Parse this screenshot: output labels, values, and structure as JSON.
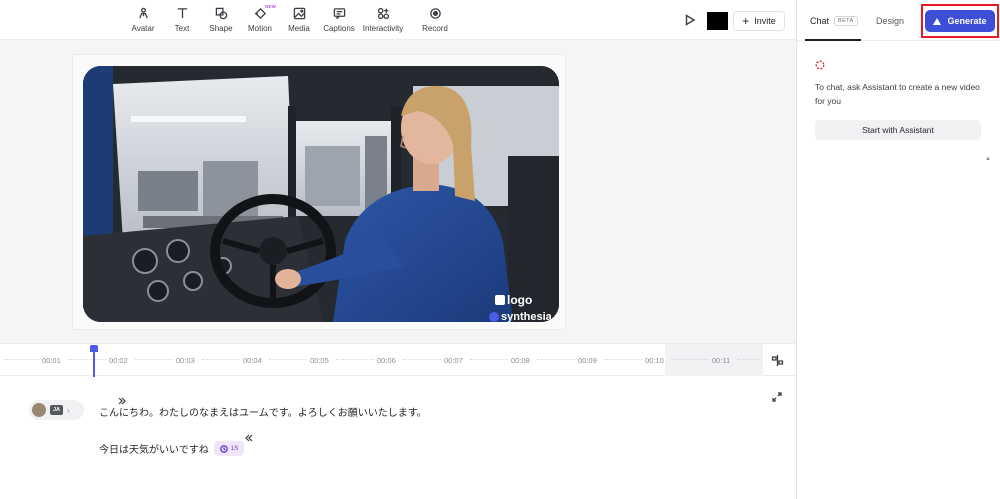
{
  "toolbar": {
    "tools": [
      {
        "label": "Avatar",
        "icon": "avatar-icon"
      },
      {
        "label": "Text",
        "icon": "text-icon"
      },
      {
        "label": "Shape",
        "icon": "shape-icon"
      },
      {
        "label": "Motion",
        "icon": "motion-icon",
        "badge": "NEW"
      },
      {
        "label": "Media",
        "icon": "media-icon"
      },
      {
        "label": "Captions",
        "icon": "captions-icon"
      },
      {
        "label": "Interactivity",
        "icon": "interactivity-icon"
      },
      {
        "label": "Record",
        "icon": "record-icon"
      }
    ],
    "invite_label": "Invite",
    "swatch_color": "#000000"
  },
  "canvas": {
    "logo_text": "logo",
    "watermark_text": "synthesia"
  },
  "timeline": {
    "ticks": [
      "00:01",
      "00:02",
      "00:03",
      "00:04",
      "00:05",
      "00:06",
      "00:07",
      "00:08",
      "00:09",
      "00:10",
      "00:11"
    ],
    "playhead_color": "#4b5ce6"
  },
  "script": {
    "avatar_lang": "JA",
    "line1": "こんにちわ。わたしのなまえはユームです。よろしくお願いいたします。",
    "line2": "今日は天気がいいですね",
    "pause_value": "1S"
  },
  "right_panel": {
    "tab_chat": "Chat",
    "tab_chat_badge": "BETA",
    "tab_design": "Design",
    "generate_label": "Generate",
    "generate_color": "#3d4fd9",
    "chat_hint": "To chat, ask Assistant to create a new video for you",
    "start_label": "Start with Assistant"
  }
}
